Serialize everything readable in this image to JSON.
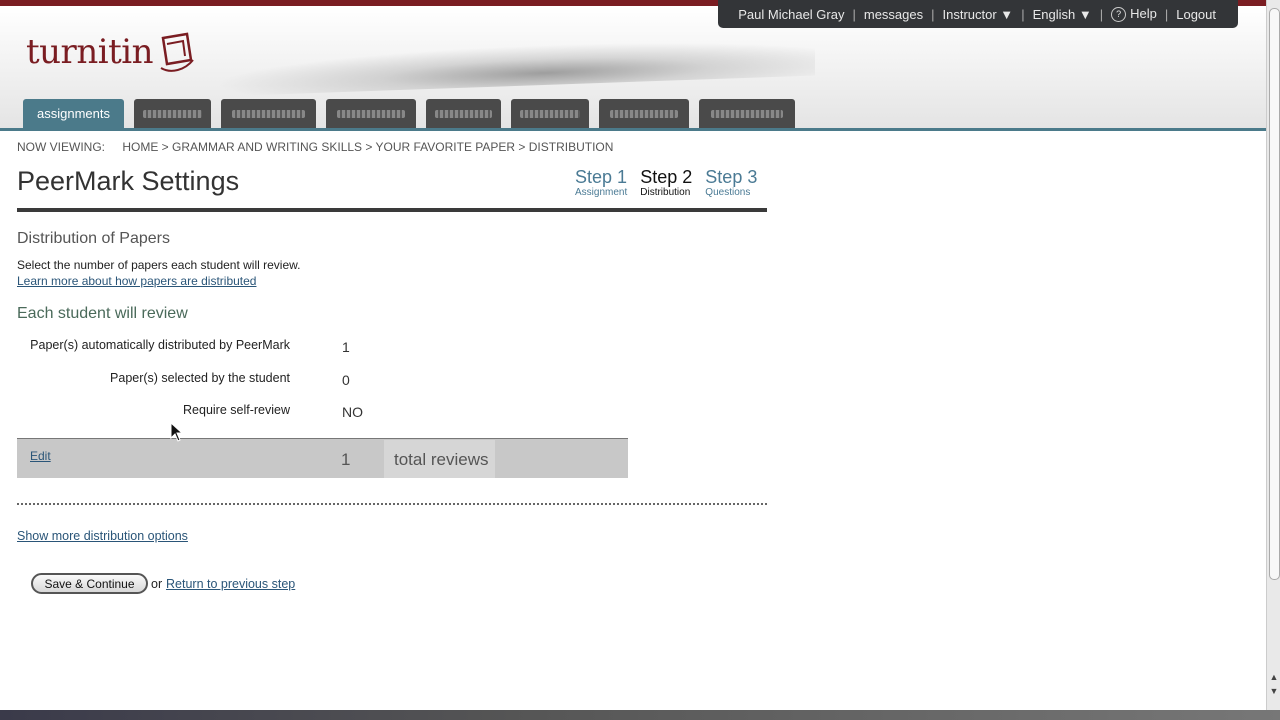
{
  "header": {
    "logo_text": "turnitin",
    "user_nav": {
      "user_name": "Paul Michael Gray",
      "messages": "messages",
      "role": "Instructor ▼",
      "language": "English ▼",
      "help": "Help",
      "logout": "Logout"
    },
    "tabs": [
      {
        "label": "assignments",
        "active": true
      }
    ]
  },
  "breadcrumb": {
    "label": "NOW VIEWING:",
    "path": "HOME > GRAMMAR AND WRITING SKILLS > YOUR FAVORITE PAPER > DISTRIBUTION"
  },
  "page": {
    "title": "PeerMark Settings",
    "steps": [
      {
        "big": "Step 1",
        "small": "Assignment"
      },
      {
        "big": "Step 2",
        "small": "Distribution"
      },
      {
        "big": "Step 3",
        "small": "Questions"
      }
    ],
    "section_title": "Distribution of Papers",
    "description": "Select the number of papers each student will review.",
    "learn_link": "Learn more about how papers are distributed",
    "sub_title": "Each student will review",
    "rows": [
      {
        "label": "Paper(s) automatically distributed by PeerMark",
        "value": "1"
      },
      {
        "label": "Paper(s) selected by the student",
        "value": "0"
      },
      {
        "label": "Require self-review",
        "value": "NO"
      }
    ],
    "total": {
      "edit": "Edit",
      "count": "1",
      "label": "total reviews"
    },
    "more_link": "Show more distribution options",
    "save_button": "Save & Continue",
    "or": "or",
    "return_link": "Return to previous step"
  },
  "colors": {
    "brand": "#7a1d22",
    "tab_active": "#4b7a8a",
    "link": "#2a5578",
    "nav_bg": "#333538"
  }
}
